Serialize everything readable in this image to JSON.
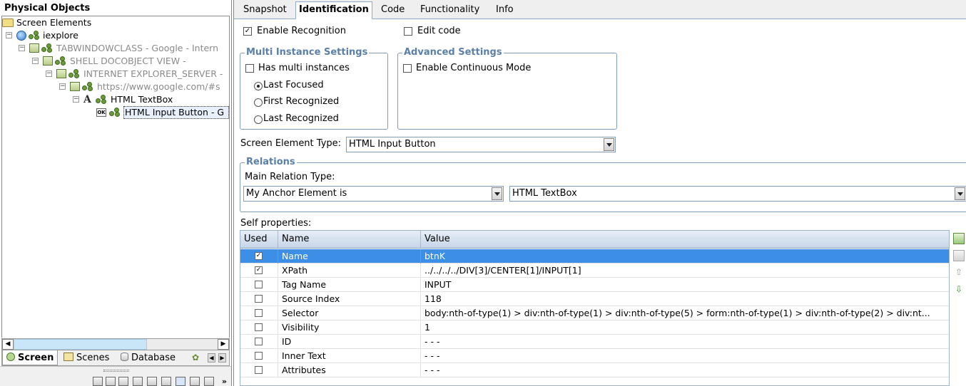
{
  "left_panel": {
    "title": "Physical Objects",
    "tree": [
      {
        "label": "Screen Elements",
        "icon": "folder-icon",
        "expander": "",
        "dim": false,
        "selected": false
      },
      {
        "label": "iexplore",
        "icon": "globe-icon",
        "expander": "−",
        "dim": false,
        "selected": false
      },
      {
        "label": "TABWINDOWCLASS - Google - Intern",
        "icon": "window-group-icon",
        "expander": "−",
        "dim": true,
        "selected": false
      },
      {
        "label": "SHELL DOCOBJECT VIEW -",
        "icon": "window-group-icon",
        "expander": "−",
        "dim": true,
        "selected": false
      },
      {
        "label": "INTERNET EXPLORER_SERVER -",
        "icon": "window-group-icon",
        "expander": "−",
        "dim": true,
        "selected": false
      },
      {
        "label": "https://www.google.com/#s",
        "icon": "window-group-icon",
        "expander": "−",
        "dim": true,
        "selected": false
      },
      {
        "label": "HTML TextBox",
        "icon": "textbox-icon",
        "expander": "−",
        "dim": false,
        "selected": false
      },
      {
        "label": "HTML Input Button - G",
        "icon": "button-icon",
        "expander": "",
        "dim": false,
        "selected": true
      }
    ],
    "bottom_tabs": [
      {
        "label": "Screen",
        "icon": "screen-icon",
        "active": true
      },
      {
        "label": "Scenes",
        "icon": "scenes-icon",
        "active": false
      },
      {
        "label": "Database",
        "icon": "database-icon",
        "active": false
      }
    ]
  },
  "tabs": [
    "Snapshot",
    "Identification",
    "Code",
    "Functionality",
    "Info"
  ],
  "active_tab": "Identification",
  "identification": {
    "enable_recognition": {
      "label": "Enable Recognition",
      "checked": true
    },
    "edit_code": {
      "label": "Edit code",
      "checked": false
    },
    "multi_instance": {
      "legend": "Multi Instance Settings",
      "has_multi": {
        "label": "Has multi instances",
        "checked": false
      },
      "options": [
        "Last Focused",
        "First Recognized",
        "Last Recognized"
      ],
      "selected_option": "Last Focused"
    },
    "advanced": {
      "legend": "Advanced Settings",
      "continuous": {
        "label": "Enable Continuous Mode",
        "checked": false
      }
    },
    "screen_element_type": {
      "label": "Screen Element Type:",
      "value": "HTML Input Button"
    },
    "relations": {
      "legend": "Relations",
      "main_relation_label": "Main Relation Type:",
      "relation_type": "My Anchor Element is",
      "anchor": "HTML TextBox"
    },
    "self_properties": {
      "label": "Self properties:",
      "columns": [
        "Used",
        "Name",
        "Value"
      ],
      "rows": [
        {
          "used": true,
          "name": "Name",
          "value": "btnK"
        },
        {
          "used": true,
          "name": "XPath",
          "value": "../../../../DIV[3]/CENTER[1]/INPUT[1]"
        },
        {
          "used": false,
          "name": "Tag Name",
          "value": "INPUT"
        },
        {
          "used": false,
          "name": "Source Index",
          "value": "118"
        },
        {
          "used": false,
          "name": "Selector",
          "value": "body:nth-of-type(1) > div:nth-of-type(1) > div:nth-of-type(5) > form:nth-of-type(1) > div:nth-of-type(2) > div:nt..."
        },
        {
          "used": false,
          "name": "Visibility",
          "value": "1"
        },
        {
          "used": false,
          "name": "ID",
          "value": "- - -"
        },
        {
          "used": false,
          "name": "Inner Text",
          "value": "- - -"
        },
        {
          "used": false,
          "name": "Attributes",
          "value": "- - -"
        }
      ],
      "selected_row": 0
    }
  },
  "colors": {
    "selection": "#3d8ee6",
    "legend": "#5a7fa8",
    "border": "#7f9db9"
  }
}
